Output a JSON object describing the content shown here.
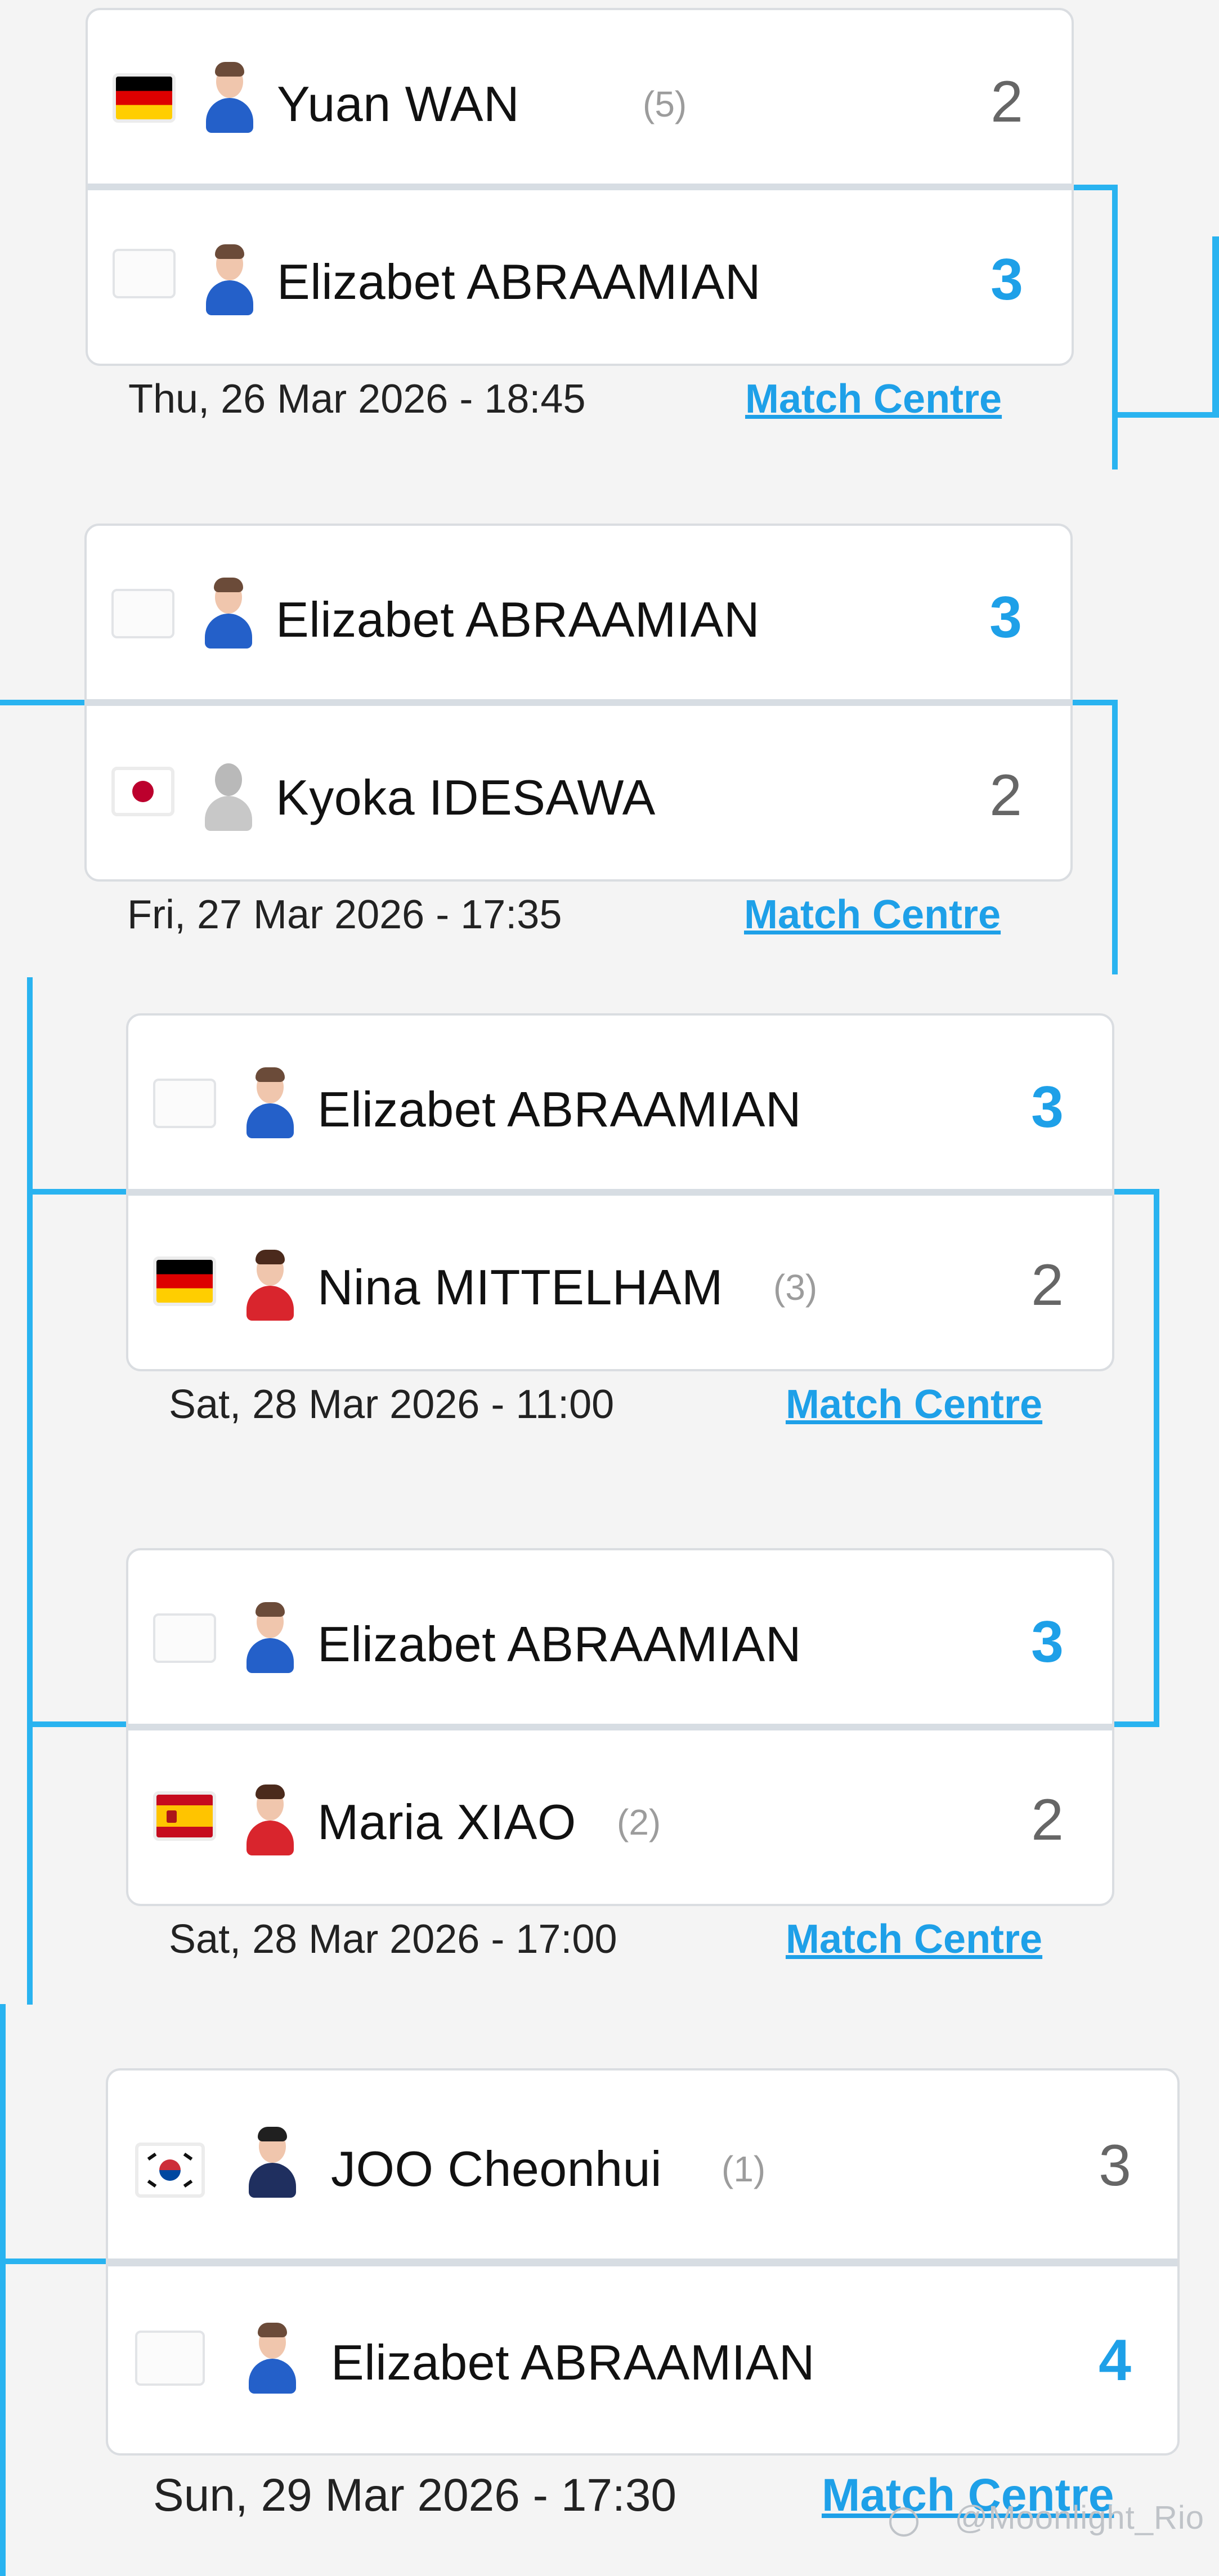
{
  "matches": [
    {
      "player1": {
        "name": "Yuan WAN",
        "seed": "(5)",
        "score": "2",
        "flag": "germany-flag"
      },
      "player2": {
        "name": "Elizabet ABRAAMIAN",
        "seed": "",
        "score": "3",
        "flag": "blank-flag"
      },
      "datetime": "Thu, 26 Mar 2026 - 18:45",
      "link": "Match Centre"
    },
    {
      "player1": {
        "name": "Elizabet ABRAAMIAN",
        "seed": "",
        "score": "3",
        "flag": "blank-flag"
      },
      "player2": {
        "name": "Kyoka IDESAWA",
        "seed": "",
        "score": "2",
        "flag": "japan-flag"
      },
      "datetime": "Fri, 27 Mar 2026 - 17:35",
      "link": "Match Centre"
    },
    {
      "player1": {
        "name": "Elizabet ABRAAMIAN",
        "seed": "",
        "score": "3",
        "flag": "blank-flag"
      },
      "player2": {
        "name": "Nina MITTELHAM",
        "seed": "(3)",
        "score": "2",
        "flag": "germany-flag"
      },
      "datetime": "Sat, 28 Mar 2026 - 11:00",
      "link": "Match Centre"
    },
    {
      "player1": {
        "name": "Elizabet ABRAAMIAN",
        "seed": "",
        "score": "3",
        "flag": "blank-flag"
      },
      "player2": {
        "name": "Maria XIAO",
        "seed": "(2)",
        "score": "2",
        "flag": "spain-flag"
      },
      "datetime": "Sat, 28 Mar 2026 - 17:00",
      "link": "Match Centre"
    },
    {
      "player1": {
        "name": "JOO Cheonhui",
        "seed": "(1)",
        "score": "3",
        "flag": "korea-flag"
      },
      "player2": {
        "name": "Elizabet ABRAAMIAN",
        "seed": "",
        "score": "4",
        "flag": "blank-flag"
      },
      "datetime": "Sun, 29 Mar 2026 - 17:30",
      "link": "Match Centre"
    }
  ],
  "watermark": "@Moonlight_Rio",
  "colors": {
    "accent": "#29b3f0",
    "winner_score": "#1ea0e8",
    "loser_score": "#666666",
    "link": "#1ea0e8",
    "background": "#f4f4f4",
    "card": "#ffffff"
  }
}
